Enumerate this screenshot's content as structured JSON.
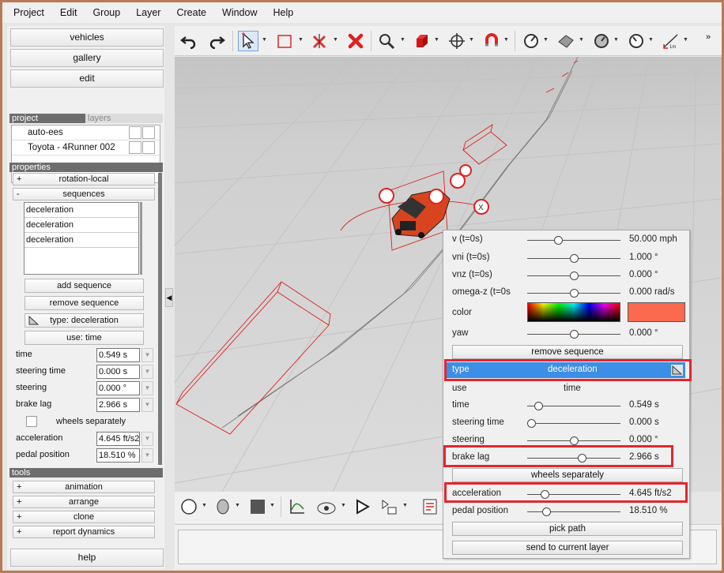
{
  "menu": [
    "Project",
    "Edit",
    "Group",
    "Layer",
    "Create",
    "Window",
    "Help"
  ],
  "nav": {
    "vehicles": "vehicles",
    "gallery": "gallery",
    "edit": "edit",
    "help": "help"
  },
  "tabs": {
    "project": "project",
    "layers": "layers"
  },
  "project_items": [
    "auto-ees",
    "Toyota - 4Runner 002"
  ],
  "properties": {
    "header": "properties",
    "rotation_local": "rotation-local",
    "sequences": "sequences",
    "sequence_items": [
      "deceleration",
      "deceleration",
      "deceleration"
    ],
    "add_sequence": "add sequence",
    "remove_sequence": "remove sequence",
    "type_button": "type: deceleration",
    "use_button": "use: time",
    "fields": [
      {
        "label": "time",
        "value": "0.549 s"
      },
      {
        "label": "steering time",
        "value": "0.000 s"
      },
      {
        "label": "steering",
        "value": "0.000 °"
      },
      {
        "label": "brake lag",
        "value": "2.966 s"
      }
    ],
    "wheels_separately": "wheels separately",
    "fields2": [
      {
        "label": "acceleration",
        "value": "4.645 ft/s2"
      },
      {
        "label": "pedal position",
        "value": "18.510 %"
      }
    ]
  },
  "tools": {
    "header": "tools",
    "items": [
      "animation",
      "arrange",
      "clone",
      "report dynamics"
    ],
    "plus": "+",
    "minus": "-"
  },
  "popup": {
    "rows": [
      {
        "label": "v (t=0s)",
        "value": "50.000 mph",
        "level": 0.32
      },
      {
        "label": "vni (t=0s)",
        "value": "1.000 °",
        "level": 0.5
      },
      {
        "label": "vnz (t=0s)",
        "value": "0.000 °",
        "level": 0.5
      },
      {
        "label": "omega-z (t=0s",
        "value": "0.000 rad/s",
        "level": 0.5
      }
    ],
    "color_label": "color",
    "accent_color": "#fb6a4f",
    "yaw": {
      "label": "yaw",
      "value": "0.000 °",
      "level": 0.5
    },
    "remove_sequence": "remove sequence",
    "type_label": "type",
    "type_value": "deceleration",
    "use_label": "use",
    "use_value": "time",
    "rows2": [
      {
        "label": "time",
        "value": "0.549 s",
        "level": 0.08
      },
      {
        "label": "steering time",
        "value": "0.000 s",
        "level": 0.0
      },
      {
        "label": "steering",
        "value": "0.000 °",
        "level": 0.5
      },
      {
        "label": "brake lag",
        "value": "2.966 s",
        "level": 0.6
      }
    ],
    "wheels_separately": "wheels separately",
    "rows3": [
      {
        "label": "acceleration",
        "value": "4.645 ft/s2",
        "level": 0.16
      },
      {
        "label": "pedal position",
        "value": "18.510 %",
        "level": 0.18
      }
    ],
    "pick_path": "pick path",
    "send_to_layer": "send to current layer",
    "highlight_color": "#e2262f"
  },
  "icons": [
    "undo-icon",
    "redo-icon",
    "select-arrow-icon",
    "rectangle-select-icon",
    "delete-vertex-icon",
    "delete-icon",
    "zoom-icon",
    "box-icon",
    "move-icon",
    "magnet-icon",
    "measure-icon",
    "surface-icon",
    "rotate-gauge-icon",
    "gauge-icon",
    "scale-1m-icon"
  ]
}
